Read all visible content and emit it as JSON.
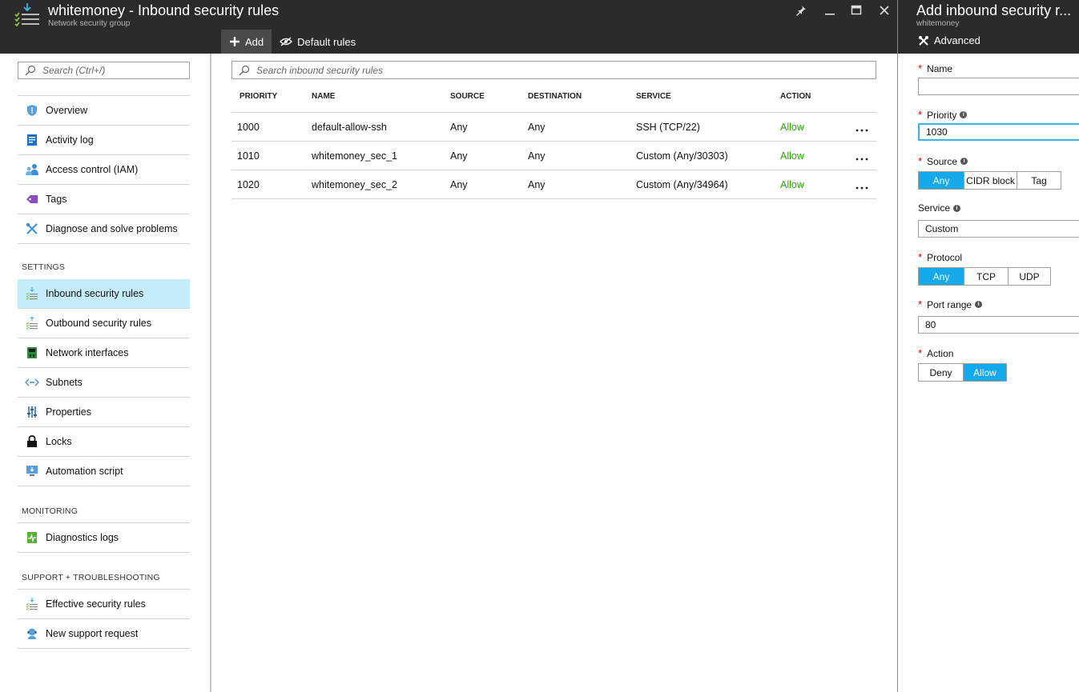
{
  "header": {
    "title": "whitemoney - Inbound security rules",
    "subtitle": "Network security group",
    "commands": {
      "add": "Add",
      "default_rules": "Default rules"
    }
  },
  "side_header": {
    "title": "Add inbound security r...",
    "subtitle": "whitemoney",
    "advanced": "Advanced"
  },
  "menu": {
    "search_placeholder": "Search (Ctrl+/)",
    "items": [
      {
        "label": "Overview",
        "icon": "shield-icon"
      },
      {
        "label": "Activity log",
        "icon": "activity-log-icon"
      },
      {
        "label": "Access control (IAM)",
        "icon": "users-icon"
      },
      {
        "label": "Tags",
        "icon": "tag-icon"
      },
      {
        "label": "Diagnose and solve problems",
        "icon": "wrench-icon"
      }
    ],
    "settings_header": "SETTINGS",
    "settings": [
      {
        "label": "Inbound security rules",
        "icon": "inbound-rules-icon",
        "selected": true
      },
      {
        "label": "Outbound security rules",
        "icon": "outbound-rules-icon"
      },
      {
        "label": "Network interfaces",
        "icon": "network-interface-icon"
      },
      {
        "label": "Subnets",
        "icon": "subnet-icon"
      },
      {
        "label": "Properties",
        "icon": "properties-icon"
      },
      {
        "label": "Locks",
        "icon": "lock-icon"
      },
      {
        "label": "Automation script",
        "icon": "automation-icon"
      }
    ],
    "monitoring_header": "MONITORING",
    "monitoring": [
      {
        "label": "Diagnostics logs",
        "icon": "diagnostics-icon"
      }
    ],
    "support_header": "SUPPORT + TROUBLESHOOTING",
    "support": [
      {
        "label": "Effective security rules",
        "icon": "effective-rules-icon"
      },
      {
        "label": "New support request",
        "icon": "support-icon"
      }
    ]
  },
  "rules": {
    "search_placeholder": "Search inbound security rules",
    "columns": [
      "PRIORITY",
      "NAME",
      "SOURCE",
      "DESTINATION",
      "SERVICE",
      "ACTION"
    ],
    "rows": [
      {
        "priority": "1000",
        "name": "default-allow-ssh",
        "source": "Any",
        "destination": "Any",
        "service": "SSH (TCP/22)",
        "action": "Allow"
      },
      {
        "priority": "1010",
        "name": "whitemoney_sec_1",
        "source": "Any",
        "destination": "Any",
        "service": "Custom (Any/30303)",
        "action": "Allow"
      },
      {
        "priority": "1020",
        "name": "whitemoney_sec_2",
        "source": "Any",
        "destination": "Any",
        "service": "Custom (Any/34964)",
        "action": "Allow"
      }
    ]
  },
  "form": {
    "name_label": "Name",
    "name_value": "",
    "priority_label": "Priority",
    "priority_value": "1030",
    "source_label": "Source",
    "source_options": [
      "Any",
      "CIDR block",
      "Tag"
    ],
    "source_selected": "Any",
    "service_label": "Service",
    "service_value": "Custom",
    "protocol_label": "Protocol",
    "protocol_options": [
      "Any",
      "TCP",
      "UDP"
    ],
    "protocol_selected": "Any",
    "port_label": "Port range",
    "port_value": "80",
    "action_label": "Action",
    "action_options": [
      "Deny",
      "Allow"
    ],
    "action_selected": "Allow"
  },
  "colors": {
    "header_bg": "#2b2b2b",
    "accent": "#13a9eb",
    "selected_bg": "#c4ecfa",
    "allow": "#2aa900",
    "required": "#e00000"
  }
}
